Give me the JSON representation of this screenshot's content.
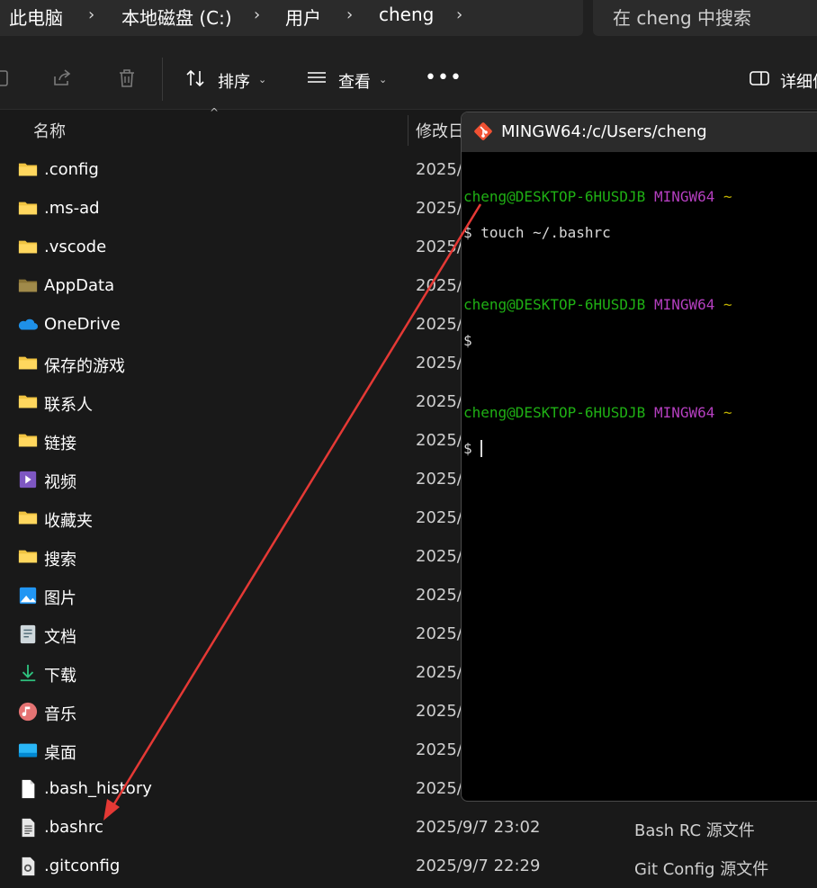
{
  "breadcrumb": [
    "此电脑",
    "本地磁盘 (C:)",
    "用户",
    "cheng"
  ],
  "search": {
    "placeholder": "在 cheng 中搜索"
  },
  "toolbar": {
    "sort_label": "排序",
    "view_label": "查看",
    "more": "•••",
    "details_label": "详细信"
  },
  "columns": {
    "name": "名称",
    "date": "修改日"
  },
  "files": [
    {
      "name": ".config",
      "date": "2025/",
      "type": "",
      "icon": "folder-icon"
    },
    {
      "name": ".ms-ad",
      "date": "2025/",
      "type": "",
      "icon": "folder-icon"
    },
    {
      "name": ".vscode",
      "date": "2025/",
      "type": "",
      "icon": "folder-icon"
    },
    {
      "name": "AppData",
      "date": "2025/",
      "type": "",
      "icon": "folder-hidden-icon"
    },
    {
      "name": "OneDrive",
      "date": "2025/",
      "type": "",
      "icon": "onedrive-cloud-icon"
    },
    {
      "name": "保存的游戏",
      "date": "2025/",
      "type": "",
      "icon": "folder-icon"
    },
    {
      "name": "联系人",
      "date": "2025/",
      "type": "",
      "icon": "folder-icon"
    },
    {
      "name": "链接",
      "date": "2025/",
      "type": "",
      "icon": "folder-icon"
    },
    {
      "name": "视频",
      "date": "2025/",
      "type": "",
      "icon": "video-folder-icon"
    },
    {
      "name": "收藏夹",
      "date": "2025/",
      "type": "",
      "icon": "folder-icon"
    },
    {
      "name": "搜索",
      "date": "2025/",
      "type": "",
      "icon": "folder-icon"
    },
    {
      "name": "图片",
      "date": "2025/",
      "type": "",
      "icon": "pictures-folder-icon"
    },
    {
      "name": "文档",
      "date": "2025/",
      "type": "",
      "icon": "documents-folder-icon"
    },
    {
      "name": "下载",
      "date": "2025/",
      "type": "",
      "icon": "download-folder-icon"
    },
    {
      "name": "音乐",
      "date": "2025/",
      "type": "",
      "icon": "music-folder-icon"
    },
    {
      "name": "桌面",
      "date": "2025/",
      "type": "",
      "icon": "desktop-folder-icon"
    },
    {
      "name": ".bash_history",
      "date": "2025/",
      "type": "",
      "icon": "file-icon"
    },
    {
      "name": ".bashrc",
      "date": "2025/9/7 23:02",
      "type": "Bash RC 源文件",
      "icon": "text-file-icon"
    },
    {
      "name": ".gitconfig",
      "date": "2025/9/7 22:29",
      "type": "Git Config 源文件",
      "icon": "config-file-icon"
    }
  ],
  "terminal": {
    "title": "MINGW64:/c/Users/cheng",
    "user_host": "cheng@DESKTOP-6HUSDJB",
    "env": "MINGW64",
    "cwd": "~",
    "prompt": "$",
    "command": "touch ~/.bashrc"
  },
  "colors": {
    "annotation_arrow": "#e53935",
    "prompt_user": "#1fb014",
    "prompt_env": "#b53fc0",
    "prompt_cwd": "#c2b300"
  }
}
